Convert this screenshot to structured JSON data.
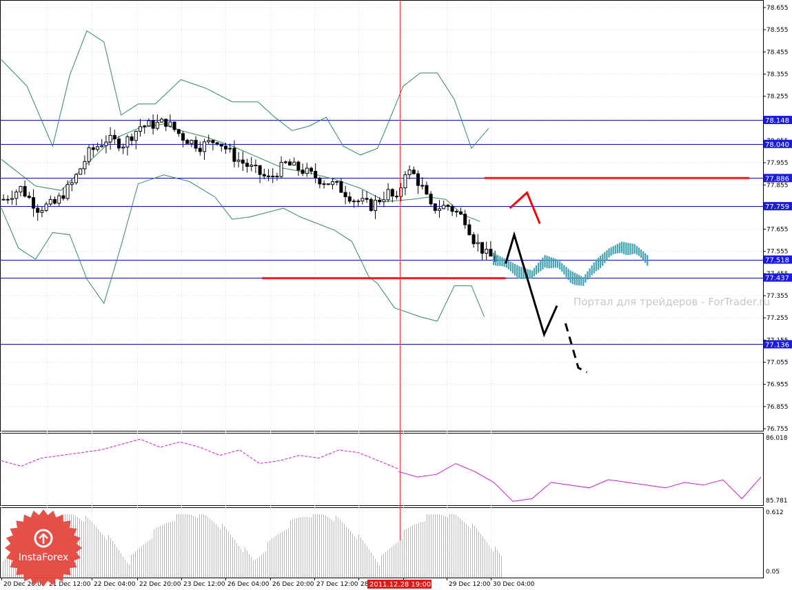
{
  "chart_data": [
    {
      "type": "line",
      "title": "",
      "panel": "price",
      "y_axis_ticks": [
        "78.655",
        "78.555",
        "78.455",
        "78.355",
        "78.255",
        "78.155",
        "78.055",
        "77.955",
        "77.855",
        "77.755",
        "77.655",
        "77.555",
        "77.455",
        "77.355",
        "77.255",
        "77.155",
        "77.055",
        "76.955",
        "76.855",
        "76.755"
      ],
      "ylim": [
        76.755,
        78.655
      ],
      "x_axis_labels": [
        "20 Dec 20:00",
        "21 Dec 12:00",
        "22 Dec 04:00",
        "22 Dec 20:00",
        "23 Dec 12:00",
        "26 Dec 04:00",
        "26 Dec 20:00",
        "27 Dec 12:00",
        "28",
        "00",
        "29 Dec 12:00",
        "30 Dec 04:00"
      ],
      "cursor_time_label": "2011.12.28 19:00",
      "horizontal_levels": [
        {
          "value": 78.148,
          "label": "78.148"
        },
        {
          "value": 78.04,
          "label": "78.040"
        },
        {
          "value": 77.886,
          "label": "77.886"
        },
        {
          "value": 77.759,
          "label": "77.759"
        },
        {
          "value": 77.518,
          "label": "77.518"
        },
        {
          "value": 77.437,
          "label": "77.437"
        },
        {
          "value": 77.136,
          "label": "77.136"
        }
      ],
      "resistance_segment": {
        "value": 77.886,
        "from_bar": 113,
        "to_bar": 175
      },
      "support_segment": {
        "value": 77.437,
        "from_bar": 61,
        "to_bar": 118
      },
      "close_path": [
        [
          0,
          77.79
        ],
        [
          4,
          77.84
        ],
        [
          8,
          77.75
        ],
        [
          12,
          77.77
        ],
        [
          16,
          77.86
        ],
        [
          20,
          78.0
        ],
        [
          24,
          78.06
        ],
        [
          28,
          78.04
        ],
        [
          32,
          78.12
        ],
        [
          36,
          78.13
        ],
        [
          38,
          78.14
        ],
        [
          42,
          78.07
        ],
        [
          46,
          78.03
        ],
        [
          50,
          78.06
        ],
        [
          54,
          77.98
        ],
        [
          58,
          77.93
        ],
        [
          62,
          77.88
        ],
        [
          66,
          77.95
        ],
        [
          70,
          77.92
        ],
        [
          74,
          77.88
        ],
        [
          78,
          77.85
        ],
        [
          82,
          77.79
        ],
        [
          86,
          77.76
        ],
        [
          90,
          77.82
        ],
        [
          92,
          77.78
        ],
        [
          94,
          77.92
        ],
        [
          96,
          77.9
        ],
        [
          98,
          77.84
        ],
        [
          100,
          77.75
        ],
        [
          104,
          77.76
        ],
        [
          108,
          77.7
        ],
        [
          110,
          77.61
        ],
        [
          113,
          77.54
        ],
        [
          115,
          77.52
        ]
      ],
      "bands_upper": [
        [
          0,
          78.42
        ],
        [
          6,
          78.3
        ],
        [
          12,
          78.03
        ],
        [
          16,
          78.35
        ],
        [
          20,
          78.55
        ],
        [
          24,
          78.5
        ],
        [
          28,
          78.17
        ],
        [
          32,
          78.22
        ],
        [
          36,
          78.22
        ],
        [
          42,
          78.33
        ],
        [
          48,
          78.29
        ],
        [
          54,
          78.23
        ],
        [
          60,
          78.23
        ],
        [
          64,
          78.16
        ],
        [
          68,
          78.1
        ],
        [
          72,
          78.12
        ],
        [
          76,
          78.16
        ],
        [
          80,
          78.03
        ],
        [
          84,
          77.99
        ],
        [
          88,
          78.02
        ],
        [
          90,
          78.11
        ],
        [
          94,
          78.3
        ],
        [
          98,
          78.36
        ],
        [
          102,
          78.36
        ],
        [
          106,
          78.24
        ],
        [
          110,
          78.02
        ],
        [
          114,
          78.11
        ]
      ],
      "bands_middle": [
        [
          0,
          77.97
        ],
        [
          8,
          77.85
        ],
        [
          14,
          77.83
        ],
        [
          20,
          77.95
        ],
        [
          26,
          78.06
        ],
        [
          32,
          78.11
        ],
        [
          38,
          78.13
        ],
        [
          42,
          78.1
        ],
        [
          48,
          78.07
        ],
        [
          54,
          78.03
        ],
        [
          60,
          77.98
        ],
        [
          66,
          77.93
        ],
        [
          72,
          77.91
        ],
        [
          78,
          77.88
        ],
        [
          84,
          77.84
        ],
        [
          88,
          77.8
        ],
        [
          90,
          77.78
        ],
        [
          96,
          77.79
        ],
        [
          100,
          77.8
        ],
        [
          104,
          77.79
        ],
        [
          108,
          77.72
        ],
        [
          112,
          77.69
        ]
      ],
      "bands_lower": [
        [
          0,
          77.75
        ],
        [
          4,
          77.57
        ],
        [
          8,
          77.52
        ],
        [
          12,
          77.64
        ],
        [
          16,
          77.63
        ],
        [
          20,
          77.43
        ],
        [
          24,
          77.32
        ],
        [
          28,
          77.58
        ],
        [
          32,
          77.86
        ],
        [
          38,
          77.9
        ],
        [
          44,
          77.87
        ],
        [
          50,
          77.8
        ],
        [
          54,
          77.7
        ],
        [
          58,
          77.71
        ],
        [
          62,
          77.73
        ],
        [
          66,
          77.75
        ],
        [
          70,
          77.71
        ],
        [
          74,
          77.68
        ],
        [
          78,
          77.65
        ],
        [
          82,
          77.6
        ],
        [
          86,
          77.44
        ],
        [
          88,
          77.41
        ],
        [
          92,
          77.3
        ],
        [
          98,
          77.26
        ],
        [
          102,
          77.24
        ],
        [
          106,
          77.4
        ],
        [
          110,
          77.4
        ],
        [
          113,
          77.26
        ]
      ],
      "forecast_bars": [
        [
          115,
          77.53
        ],
        [
          118,
          77.5
        ],
        [
          121,
          77.47
        ],
        [
          124,
          77.45
        ],
        [
          127,
          77.52
        ],
        [
          130,
          77.5
        ],
        [
          133,
          77.45
        ],
        [
          136,
          77.42
        ],
        [
          139,
          77.5
        ],
        [
          142,
          77.55
        ],
        [
          145,
          77.58
        ],
        [
          148,
          77.57
        ],
        [
          151,
          77.52
        ]
      ],
      "forecast_arrows": [
        {
          "color": "#000000",
          "style": "solid",
          "points": [
            [
              118,
              77.5
            ],
            [
              120,
              77.63
            ],
            [
              127,
              77.18
            ],
            [
              130,
              77.31
            ]
          ]
        },
        {
          "color": "#000000",
          "style": "dashed",
          "points": [
            [
              132,
              77.23
            ],
            [
              135,
              77.03
            ],
            [
              137,
              77.01
            ]
          ]
        },
        {
          "color": "#ff0000",
          "style": "solid",
          "points": [
            [
              119,
              77.75
            ],
            [
              123,
              77.82
            ],
            [
              126,
              77.68
            ]
          ]
        }
      ],
      "watermark": "Портал для трейдеров - ForTrader.ru"
    },
    {
      "type": "line",
      "panel": "oscillator",
      "y_axis_ticks": [
        "86.018",
        "85.781"
      ],
      "ylim": [
        85.781,
        86.018
      ],
      "values_dashed": [
        85.93,
        85.91,
        85.94,
        85.95,
        85.96,
        85.97,
        85.99,
        86.01,
        85.98,
        86.0,
        85.98,
        85.95,
        85.97,
        85.92,
        85.93,
        85.95,
        85.94,
        85.97,
        85.96,
        85.93,
        85.9
      ],
      "values_solid": [
        85.89,
        85.87,
        85.88,
        85.92,
        85.89,
        85.85,
        85.78,
        85.79,
        85.85,
        85.84,
        85.83,
        85.86,
        85.85,
        85.84,
        85.83,
        85.85,
        85.84,
        85.86,
        85.79,
        85.87
      ]
    },
    {
      "type": "bar",
      "panel": "volume",
      "y_axis_ticks": [
        "0.612",
        "0.05"
      ],
      "ylim": [
        0.05,
        0.612
      ]
    }
  ],
  "brand": {
    "name": "InstaForex"
  },
  "colors": {
    "level_line": "#0000cc",
    "level_badge": "#1a1ae0",
    "band": "#2e8b57",
    "red_segment": "#ff1a1a",
    "forecast_bar": "#3fa4b0",
    "oscillator": "#d018d0",
    "volume_bar": "#b4b4b4",
    "cursor": "#ff3030",
    "grid": "#dcdcdc"
  }
}
